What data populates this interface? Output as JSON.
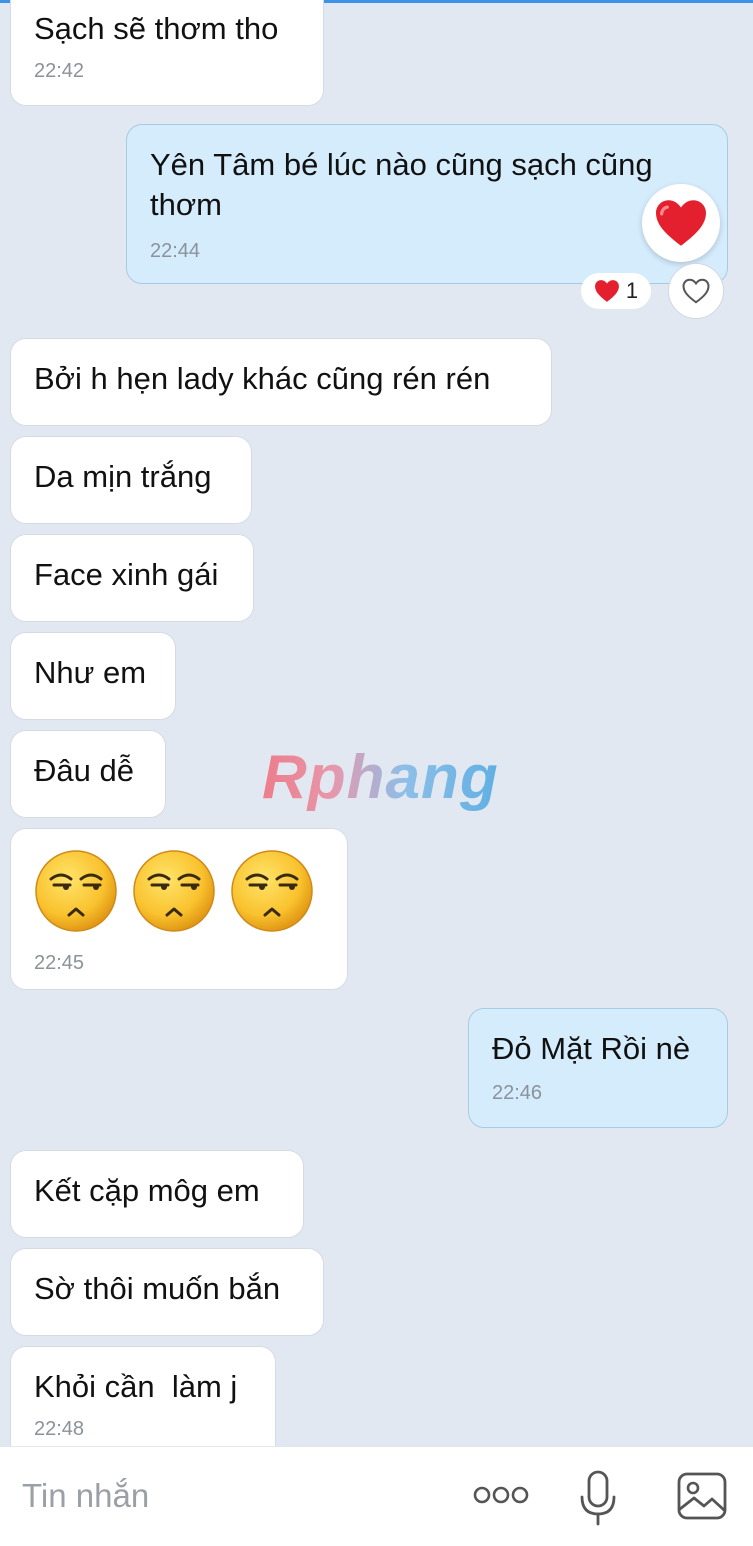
{
  "messages": [
    {
      "side": "them",
      "text": "Sạch sẽ thơm tho",
      "time": "22:42"
    },
    {
      "side": "me",
      "text": "Yên Tâm bé lúc nào cũng sạch cũng thơm",
      "time": "22:44",
      "reaction_count": "1"
    },
    {
      "side": "them",
      "text": "Bởi h hẹn lady khác cũng rén rén"
    },
    {
      "side": "them",
      "text": "Da mịn trắng"
    },
    {
      "side": "them",
      "text": "Face xinh gái"
    },
    {
      "side": "them",
      "text": "Như em"
    },
    {
      "side": "them",
      "text": "Đâu dễ"
    },
    {
      "side": "them",
      "emoji": [
        "smirk-face-icon",
        "smirk-face-icon",
        "smirk-face-icon"
      ],
      "time": "22:45"
    },
    {
      "side": "me",
      "text": "Đỏ Mặt Rồi nè",
      "time": "22:46"
    },
    {
      "side": "them",
      "text": "Kết cặp môg em"
    },
    {
      "side": "them",
      "text": "Sờ thôi muốn bắn"
    },
    {
      "side": "them",
      "text": "Khỏi cần  làm j",
      "time": "22:48"
    }
  ],
  "watermark": "Rphang",
  "composer": {
    "placeholder": "Tin nhắn",
    "icons": [
      "more-icon",
      "microphone-icon",
      "image-icon"
    ]
  },
  "colors": {
    "background": "#e2e8f1",
    "incoming_bubble": "#ffffff",
    "outgoing_bubble": "#d5ecfd",
    "heart": "#e5202e",
    "accent": "#3d94e6"
  }
}
